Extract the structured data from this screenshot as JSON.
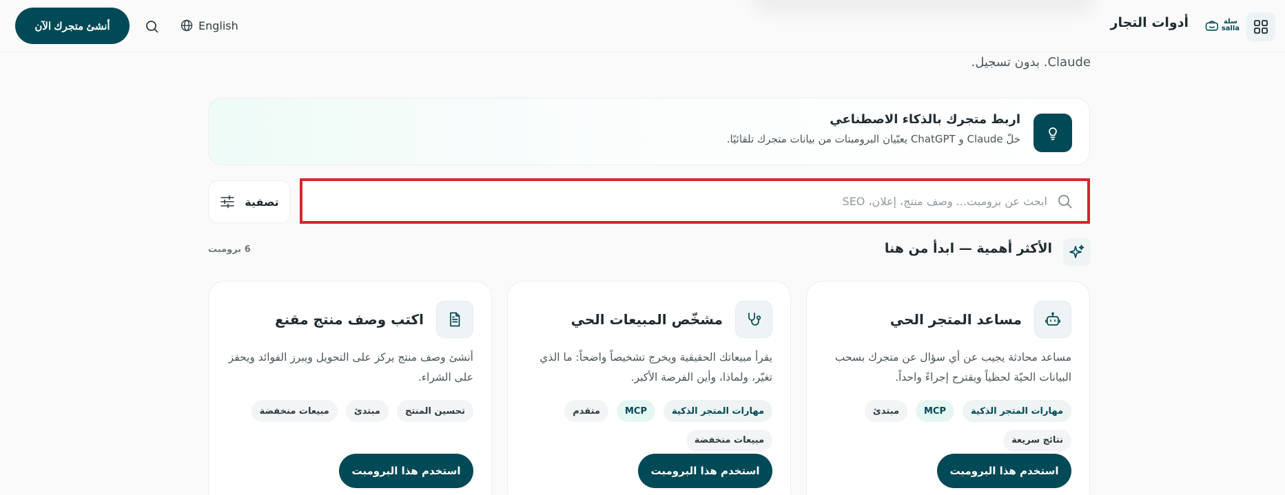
{
  "header": {
    "brand_title": "أدوات التجار",
    "logo_text_top": "سلة",
    "logo_text_bottom": "salla",
    "language_label": "English",
    "cta_label": "أنشئ متجرك الآن"
  },
  "intro_tail": "Claude. بدون تسجيل.",
  "ai_banner": {
    "title": "اربط متجرك بالذكاء الاصطناعي",
    "description": "خلّ Claude و ChatGPT يعبّيان البرومبتات من بيانات متجرك تلقائيًا."
  },
  "filter": {
    "label": "تصفية"
  },
  "search": {
    "placeholder": "ابحث عن برومبت... وصف منتج، إعلان، SEO",
    "value": ""
  },
  "section": {
    "title": "الأكثر أهمية — ابدأ من هنا",
    "count": "6 برومبت"
  },
  "cards": [
    {
      "title": "مساعد المتجر الحي",
      "icon": "robot-icon",
      "description": "مساعد محادثة يجيب عن أي سؤال عن متجرك بسحب البيانات الحيّة لحظياً ويقترح إجراءً واحداً.",
      "tags": [
        "مهارات المتجر الذكية",
        "MCP",
        "مبتدئ",
        "نتائج سريعة"
      ],
      "button_label": "استخدم هذا البرومبت"
    },
    {
      "title": "مشخّص المبيعات الحي",
      "icon": "stethoscope-icon",
      "description": "يقرأ مبيعاتك الحقيقية ويخرج تشخيصاً واضحاً: ما الذي تغيّر، ولماذا، وأين الفرصة الأكبر.",
      "tags": [
        "مهارات المتجر الذكية",
        "MCP",
        "متقدم",
        "مبيعات منخفضة"
      ],
      "button_label": "استخدم هذا البرومبت"
    },
    {
      "title": "اكتب وصف منتج مقنع",
      "icon": "document-icon",
      "description": "أنشئ وصف منتج يركز على التحويل ويبرز الفوائد ويحفز على الشراء.",
      "tags": [
        "تحسين المنتج",
        "مبتدئ",
        "مبيعات منخفضة"
      ],
      "button_label": "استخدم هذا البرومبت"
    }
  ],
  "colors": {
    "brand": "#004956",
    "highlight_border": "#d9232d",
    "mcp_tag_bg": "#e6f7f3"
  }
}
